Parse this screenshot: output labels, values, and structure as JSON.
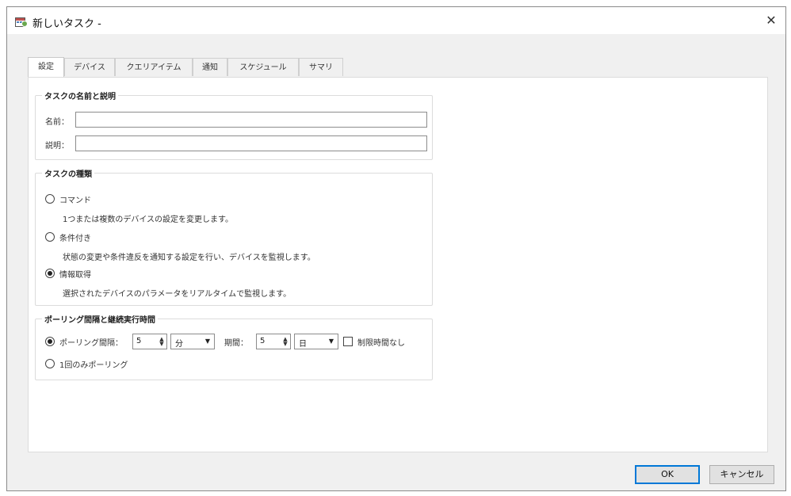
{
  "window": {
    "title": "新しいタスク -",
    "close_glyph": "✕"
  },
  "tabs": [
    {
      "label": "設定",
      "active": true
    },
    {
      "label": "デバイス",
      "active": false
    },
    {
      "label": "クエリアイテム",
      "active": false
    },
    {
      "label": "通知",
      "active": false
    },
    {
      "label": "スケジュール",
      "active": false
    },
    {
      "label": "サマリ",
      "active": false
    }
  ],
  "name_group": {
    "title": "タスクの名前と説明",
    "name_label": "名前：",
    "name_value": "",
    "desc_label": "説明：",
    "desc_value": ""
  },
  "type_group": {
    "title": "タスクの種類",
    "options": [
      {
        "label": "コマンド",
        "desc": "1つまたは複数のデバイスの設定を変更します。",
        "selected": false
      },
      {
        "label": "条件付き",
        "desc": "状態の変更や条件違反を通知する設定を行い、デバイスを監視します。",
        "selected": false
      },
      {
        "label": "情報取得",
        "desc": "選択されたデバイスのパラメータをリアルタイムで監視します。",
        "selected": true
      }
    ]
  },
  "polling_group": {
    "title": "ポーリング間隔と継続実行時間",
    "interval_label": "ポーリング間隔：",
    "interval_value": "5",
    "interval_unit": "分",
    "period_label": "期間：",
    "period_value": "5",
    "period_unit": "日",
    "unlimited_label": "制限時間なし",
    "unlimited_checked": false,
    "once_label": "1回のみポーリング",
    "mode": "interval"
  },
  "footer": {
    "ok_label": "OK",
    "cancel_label": "キャンセル"
  },
  "colors": {
    "window_bg": "#f0f0f0",
    "panel_bg": "#ffffff",
    "ok_border": "#0078d7"
  }
}
